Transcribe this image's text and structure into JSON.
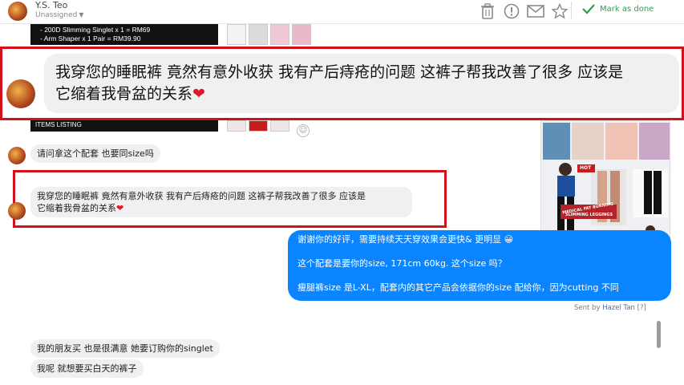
{
  "header": {
    "contact_name": "Y.S. Teo",
    "assign_status": "Unassigned",
    "mark_done_label": "Mark as done",
    "icons": [
      "trash-icon",
      "alert-icon",
      "mail-icon",
      "star-icon",
      "check-icon"
    ]
  },
  "ad": {
    "line1": "- 200D Slimming Singlet x 1 = RM69",
    "line2": "- Arm Shaper x 1 Pair = RM39.90",
    "listing_label": "ITEMS LISTING"
  },
  "highlight": {
    "message_line1": "我穿您的睡眠裤  竟然有意外收获  我有产后痔疮的问题  这裤子帮我改善了很多  应该是",
    "message_line2": "它缩着我骨盆的关系"
  },
  "messages": {
    "incoming1": "请问拿这个配套  也要同size吗",
    "incoming2_line1": "我穿您的睡眠裤  竟然有意外收获  我有产后痔疮的问题  这裤子帮我改善了很多  应该是",
    "incoming2_line2": "它缩着我骨盆的关系",
    "incoming3": "我的朋友买  也是很满意  她要订购你的singlet",
    "incoming4": "我呢  就想要买白天的裤子"
  },
  "reply": {
    "line1": "谢谢你的好评，需要持续天天穿效果会更快& 更明显",
    "line2": "这个配套是要你的size, 171cm 60kg. 这个size 吗？",
    "line3": "瘦腿裤size 是L-XL，配套内的其它产品会依据你的size 配给你，因为cutting 不同",
    "sent_by_prefix": "Sent by",
    "sent_by_name": "Hazel Tan",
    "sent_by_help": "[?]"
  },
  "product": {
    "label1": "MEDICAL FAT BURNING",
    "label2": "SLIMMING LEGGINGS",
    "badge": "HOT"
  },
  "colors": {
    "highlight_border": "#d1121b",
    "reply_bubble": "#0a84ff",
    "mark_done": "#2e9e4f",
    "incoming_bubble": "#f1f0f0"
  }
}
